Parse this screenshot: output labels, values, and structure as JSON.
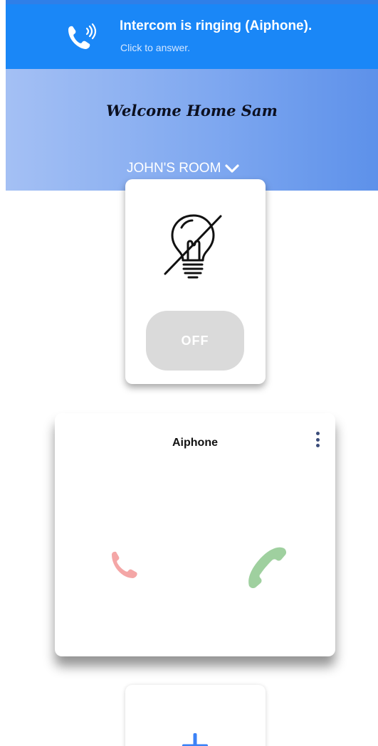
{
  "notification": {
    "title": "Intercom is ringing (Aiphone).",
    "subtitle": "Click to answer.",
    "icon": "phone-ringing-icon",
    "color": "#1a87f7"
  },
  "header": {
    "welcome": "Welcome Home Sam",
    "room": "JOHN'S ROOM",
    "room_icon": "chevron-down-icon"
  },
  "light_card": {
    "icon": "lightbulb-off-icon",
    "state_label": "OFF"
  },
  "intercom_card": {
    "title": "Aiphone",
    "menu_icon": "more-vertical-icon",
    "decline_icon": "phone-hangup-icon",
    "answer_icon": "phone-answer-icon",
    "decline_color": "#f4a6a6",
    "answer_color": "#9fd09f"
  },
  "add_card": {
    "icon": "plus-icon",
    "color": "#3b82f6"
  }
}
